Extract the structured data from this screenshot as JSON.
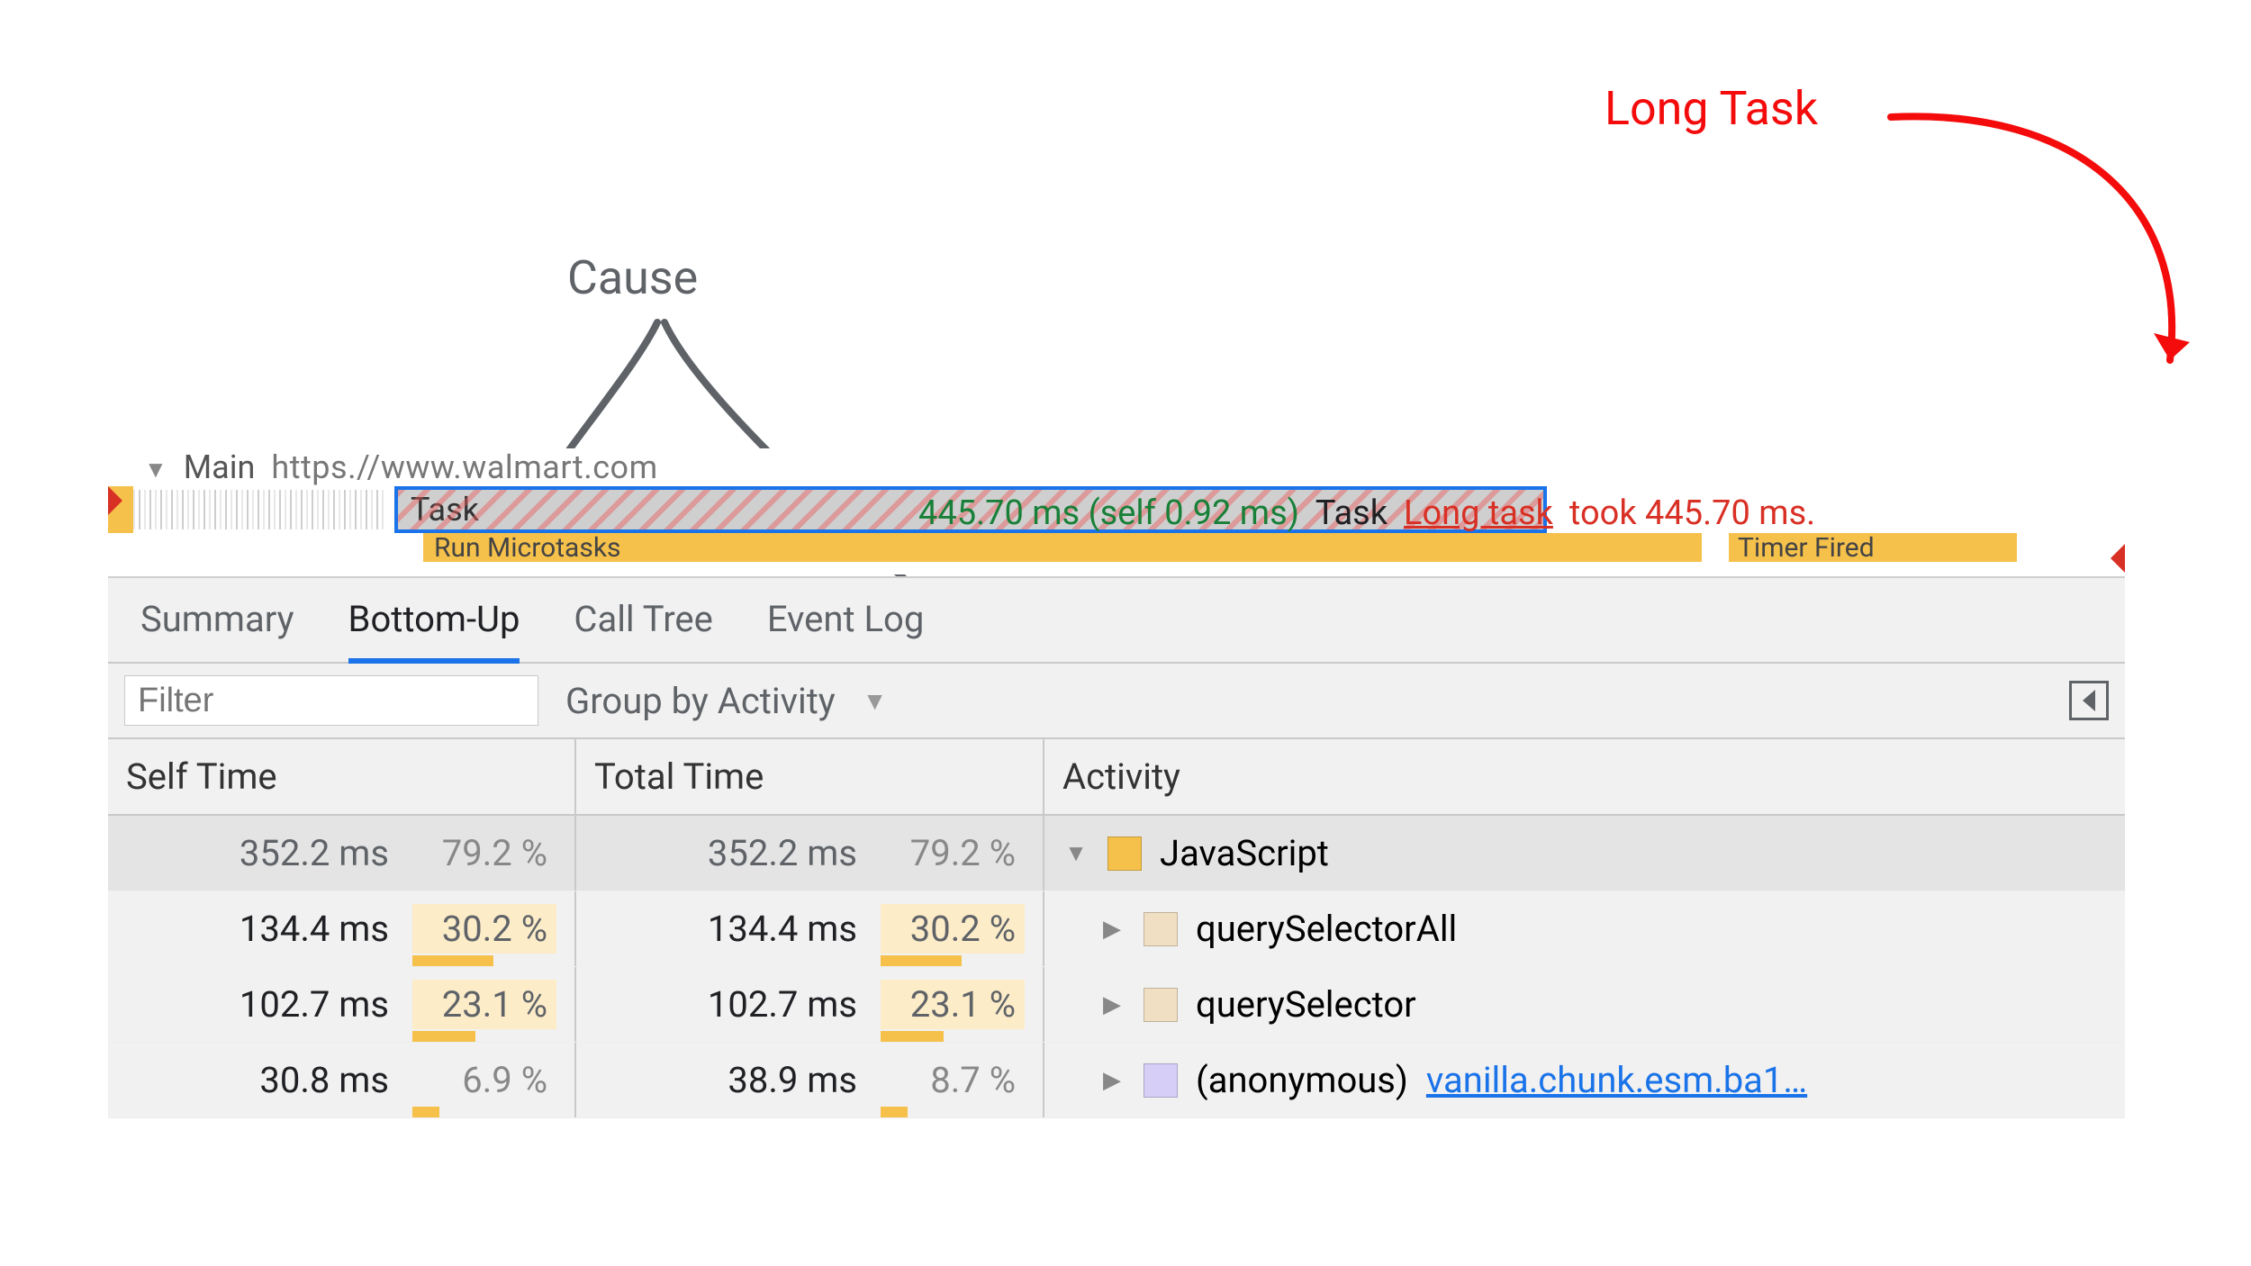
{
  "annotations": {
    "long_task": "Long Task",
    "cause": "Cause"
  },
  "flame": {
    "main_label": "Main",
    "main_url_cut": "https.//www.walmart.com",
    "task_label": "Task",
    "microtasks_label_cut": "Run Microtasks",
    "timer_fired_cut": "Timer Fired"
  },
  "tooltip": {
    "time_green": "445.70 ms (self 0.92 ms)",
    "label_black": "Task",
    "long_task_red": "Long task",
    "long_task_red_rest": "took 445.70 ms."
  },
  "tabs": {
    "summary": "Summary",
    "bottom_up": "Bottom-Up",
    "call_tree": "Call Tree",
    "event_log": "Event Log"
  },
  "filter": {
    "placeholder": "Filter",
    "group_by": "Group by Activity"
  },
  "headers": {
    "self": "Self Time",
    "total": "Total Time",
    "activity": "Activity"
  },
  "rows": [
    {
      "self_ms": "352.2 ms",
      "self_pct": "79.2 %",
      "total_ms": "352.2 ms",
      "total_pct": "79.2 %",
      "open": true,
      "swatch": "sw-yellow",
      "name": "JavaScript",
      "link": "",
      "indent": 0
    },
    {
      "self_ms": "134.4 ms",
      "self_pct": "30.2 %",
      "total_ms": "134.4 ms",
      "total_pct": "30.2 %",
      "open": false,
      "swatch": "sw-tan",
      "name": "querySelectorAll",
      "link": "",
      "indent": 1
    },
    {
      "self_ms": "102.7 ms",
      "self_pct": "23.1 %",
      "total_ms": "102.7 ms",
      "total_pct": "23.1 %",
      "open": false,
      "swatch": "sw-tan",
      "name": "querySelector",
      "link": "",
      "indent": 1
    },
    {
      "self_ms": "30.8 ms",
      "self_pct": "6.9 %",
      "total_ms": "38.9 ms",
      "total_pct": "8.7 %",
      "open": false,
      "swatch": "sw-violet",
      "name": "(anonymous)",
      "link": "vanilla.chunk.esm.ba1…",
      "indent": 1
    }
  ]
}
